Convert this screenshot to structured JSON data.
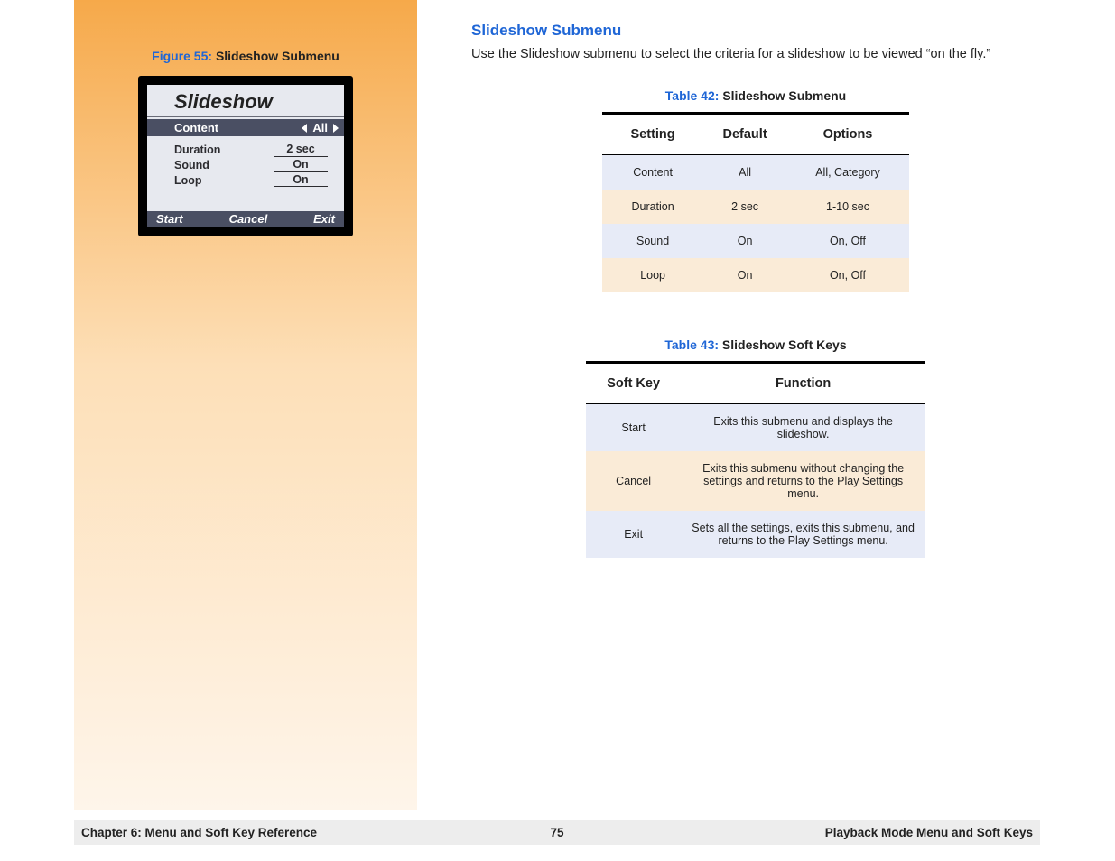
{
  "sidebar": {
    "figure_label": "Figure 55:",
    "figure_title": "Slideshow Submenu",
    "screen_title": "Slideshow",
    "selected": {
      "label": "Content",
      "value": "All"
    },
    "options": [
      {
        "label": "Duration",
        "value": "2 sec"
      },
      {
        "label": "Sound",
        "value": "On"
      },
      {
        "label": "Loop",
        "value": "On"
      }
    ],
    "softkeys": {
      "left": "Start",
      "center": "Cancel",
      "right": "Exit"
    }
  },
  "main": {
    "heading": "Slideshow Submenu",
    "intro": "Use the Slideshow submenu to select the criteria for a slideshow to be viewed “on the fly.”",
    "table42": {
      "label": "Table 42:",
      "title": "Slideshow Submenu",
      "headers": [
        "Setting",
        "Default",
        "Options"
      ],
      "rows": [
        {
          "cells": [
            "Content",
            "All",
            "All, Category"
          ]
        },
        {
          "cells": [
            "Duration",
            "2 sec",
            "1-10 sec"
          ]
        },
        {
          "cells": [
            "Sound",
            "On",
            "On, Off"
          ]
        },
        {
          "cells": [
            "Loop",
            "On",
            "On, Off"
          ]
        }
      ]
    },
    "table43": {
      "label": "Table 43:",
      "title": "Slideshow Soft Keys",
      "headers": [
        "Soft Key",
        "Function"
      ],
      "rows": [
        {
          "cells": [
            "Start",
            "Exits this submenu and displays the slideshow."
          ]
        },
        {
          "cells": [
            "Cancel",
            "Exits this submenu without changing the settings and returns to the Play Settings menu."
          ]
        },
        {
          "cells": [
            "Exit",
            "Sets all the settings, exits this submenu, and returns to the Play Settings menu."
          ]
        }
      ]
    }
  },
  "footer": {
    "left": "Chapter 6: Menu and Soft Key Reference",
    "center": "75",
    "right": "Playback Mode Menu and Soft Keys"
  }
}
